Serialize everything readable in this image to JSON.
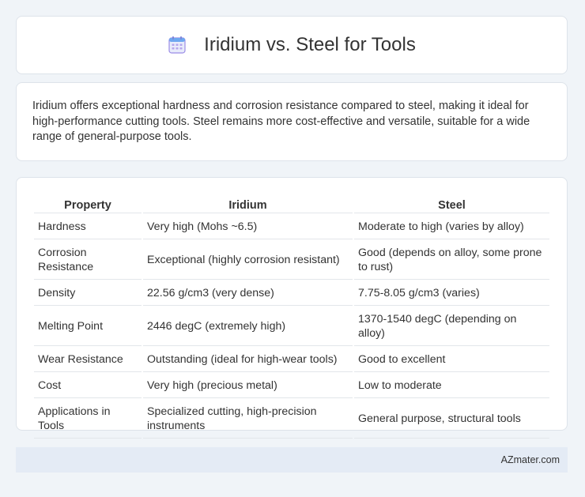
{
  "header": {
    "title": "Iridium vs. Steel for Tools",
    "icon": "calendar-icon"
  },
  "summary": {
    "text": "Iridium offers exceptional hardness and corrosion resistance compared to steel, making it ideal for high-performance cutting tools. Steel remains more cost-effective and versatile, suitable for a wide range of general-purpose tools."
  },
  "table": {
    "headers": [
      "Property",
      "Iridium",
      "Steel"
    ],
    "rows": [
      [
        "Hardness",
        "Very high (Mohs ~6.5)",
        "Moderate to high (varies by alloy)"
      ],
      [
        "Corrosion Resistance",
        "Exceptional (highly corrosion resistant)",
        "Good (depends on alloy, some prone to rust)"
      ],
      [
        "Density",
        "22.56 g/cm3 (very dense)",
        "7.75-8.05 g/cm3 (varies)"
      ],
      [
        "Melting Point",
        "2446 degC (extremely high)",
        "1370-1540 degC (depending on alloy)"
      ],
      [
        "Wear Resistance",
        "Outstanding (ideal for high-wear tools)",
        "Good to excellent"
      ],
      [
        "Cost",
        "Very high (precious metal)",
        "Low to moderate"
      ],
      [
        "Applications in Tools",
        "Specialized cutting, high-precision instruments",
        "General purpose, structural tools"
      ]
    ]
  },
  "footer": {
    "source": "AZmater.com"
  },
  "colors": {
    "background": "#f0f4f8",
    "card": "#ffffff",
    "footer_bg": "#e4ebf5",
    "icon_blue": "#6ea8f0",
    "icon_purple": "#9b8ce6"
  }
}
